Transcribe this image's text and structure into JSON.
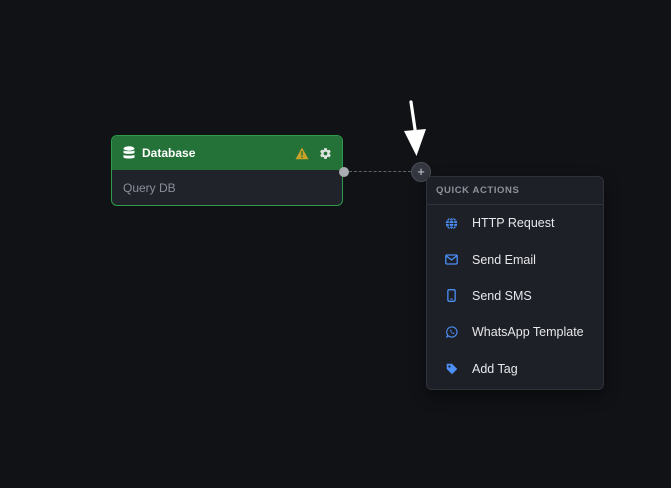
{
  "node": {
    "title": "Database",
    "subtitle": "Query DB",
    "header_color": "#247238",
    "border_color": "#2f9a4b"
  },
  "connector": {
    "add_label": "+"
  },
  "menu": {
    "header": "QUICK ACTIONS",
    "accent": "#4b8ff7",
    "items": [
      {
        "label": "HTTP Request",
        "icon": "globe-icon"
      },
      {
        "label": "Send Email",
        "icon": "mail-icon"
      },
      {
        "label": "Send SMS",
        "icon": "phone-icon"
      },
      {
        "label": "WhatsApp Template",
        "icon": "whatsapp-icon"
      },
      {
        "label": "Add Tag",
        "icon": "tag-icon"
      }
    ]
  }
}
